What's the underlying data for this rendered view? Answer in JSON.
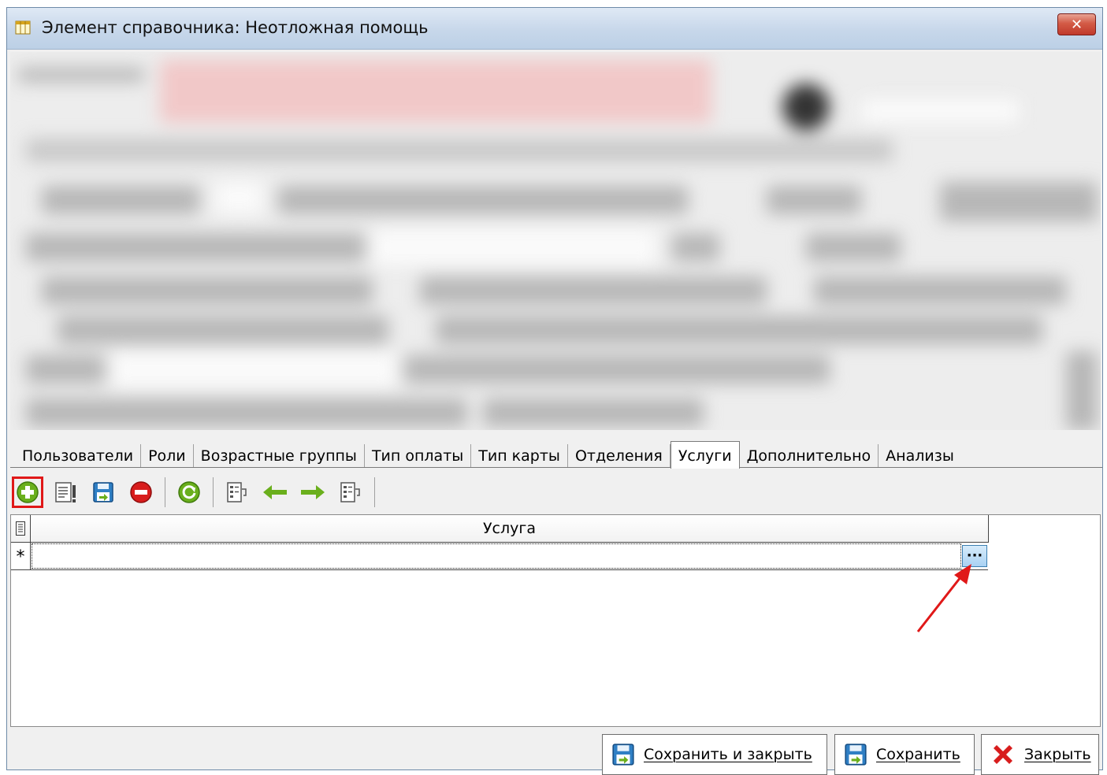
{
  "window": {
    "title": "Элемент справочника: Неотложная помощь",
    "close_label": "✕"
  },
  "tabs": [
    {
      "label": "Пользователи",
      "active": false
    },
    {
      "label": "Роли",
      "active": false
    },
    {
      "label": "Возрастные группы",
      "active": false
    },
    {
      "label": "Тип оплаты",
      "active": false
    },
    {
      "label": "Тип карты",
      "active": false
    },
    {
      "label": "Отделения",
      "active": false
    },
    {
      "label": "Услуги",
      "active": true
    },
    {
      "label": "Дополнительно",
      "active": false
    },
    {
      "label": "Анализы",
      "active": false
    }
  ],
  "toolbar": {
    "icons": [
      "add-icon",
      "edit-icon",
      "save-icon",
      "delete-icon",
      "refresh-icon",
      "move-in-icon",
      "arrow-left-icon",
      "arrow-right-icon",
      "move-out-icon"
    ]
  },
  "grid": {
    "columns": [
      "Услуга"
    ],
    "new_row_indicator": "*",
    "ellipsis_label": "···"
  },
  "footer": {
    "save_close_label": "Сохранить и закрыть",
    "save_label": "Сохранить",
    "close_label": "Закрыть"
  },
  "colors": {
    "accent_green": "#6aaf1c",
    "delete_red": "#d81d1d",
    "highlight_red": "#e01818",
    "titlebar": "#c7d7ea"
  }
}
